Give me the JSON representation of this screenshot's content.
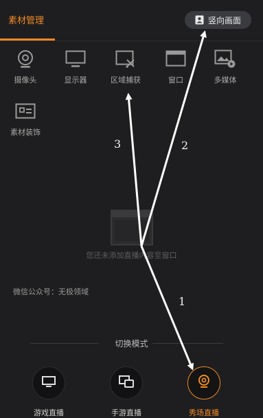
{
  "header": {
    "active_tab": "素材管理",
    "portrait_button": "竖向画面",
    "accent_color": "#f08a24"
  },
  "sources": [
    {
      "label": "摄像头",
      "icon": "camera-icon"
    },
    {
      "label": "显示器",
      "icon": "monitor-icon"
    },
    {
      "label": "区域捕获",
      "icon": "region-capture-icon"
    },
    {
      "label": "窗口",
      "icon": "window-icon"
    },
    {
      "label": "多媒体",
      "icon": "media-icon"
    },
    {
      "label": "素材装饰",
      "icon": "decoration-icon"
    }
  ],
  "empty_state": {
    "text": "您还未添加直播内容至窗口",
    "icon": "window-empty-icon"
  },
  "watermark": "微信公众号：无极领域",
  "mode_section": {
    "title": "切换模式",
    "modes": [
      {
        "label": "游戏直播",
        "icon": "tv-icon",
        "active": false
      },
      {
        "label": "手游直播",
        "icon": "mobile-screen-icon",
        "active": false
      },
      {
        "label": "秀场直播",
        "icon": "webcam-icon",
        "active": true
      }
    ]
  },
  "annotations": {
    "label_1": "1",
    "label_2": "2",
    "label_3": "3",
    "arrow_color": "#ffffff"
  }
}
